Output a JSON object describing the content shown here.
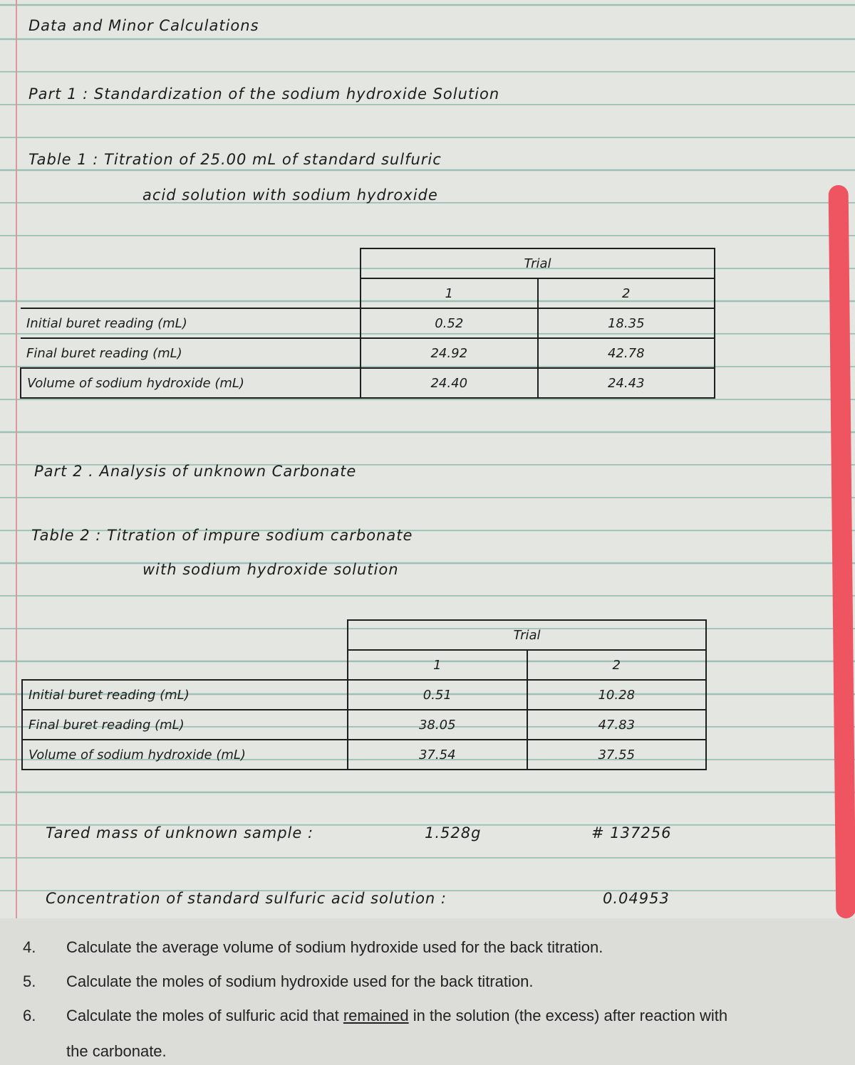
{
  "page": {
    "title": "Data and Minor Calculations",
    "part1_heading": "Part 1 : Standardization of the sodium hydroxide Solution",
    "table1": {
      "caption_line1": "Table 1 : Titration of 25.00 mL of standard sulfuric",
      "caption_line2": "acid solution with sodium hydroxide",
      "header": "Trial",
      "trials": [
        "1",
        "2"
      ],
      "rows": [
        {
          "label": "Initial buret reading (mL)",
          "values": [
            "0.52",
            "18.35"
          ]
        },
        {
          "label": "Final buret reading (mL)",
          "values": [
            "24.92",
            "42.78"
          ]
        },
        {
          "label": "Volume of sodium hydroxide (mL)",
          "values": [
            "24.40",
            "24.43"
          ]
        }
      ]
    },
    "part2_heading": "Part 2 . Analysis of unknown Carbonate",
    "table2": {
      "caption_line1": "Table 2 : Titration of impure sodium carbonate",
      "caption_line2": "with sodium hydroxide solution",
      "header": "Trial",
      "trials": [
        "1",
        "2"
      ],
      "rows": [
        {
          "label": "Initial buret reading (mL)",
          "values": [
            "0.51",
            "10.28"
          ]
        },
        {
          "label": "Final buret reading (mL)",
          "values": [
            "38.05",
            "47.83"
          ]
        },
        {
          "label": "Volume of sodium hydroxide (mL)",
          "values": [
            "37.54",
            "37.55"
          ]
        }
      ]
    },
    "tared_mass_label": "Tared mass of unknown sample :",
    "tared_mass_value": "1.528g",
    "sample_number": "# 137256",
    "concentration_label": "Concentration of standard sulfuric acid solution :",
    "concentration_value": "0.04953"
  },
  "questions": [
    {
      "number": "4.",
      "text": "Calculate the average volume of sodium hydroxide used for the back titration."
    },
    {
      "number": "5.",
      "text": "Calculate the moles of sodium hydroxide used for the back titration."
    },
    {
      "number": "6.",
      "text_before": "Calculate the moles of sulfuric acid that ",
      "underlined": "remained",
      "text_after": " in the solution (the excess) after reaction with",
      "continuation": "the carbonate."
    }
  ]
}
